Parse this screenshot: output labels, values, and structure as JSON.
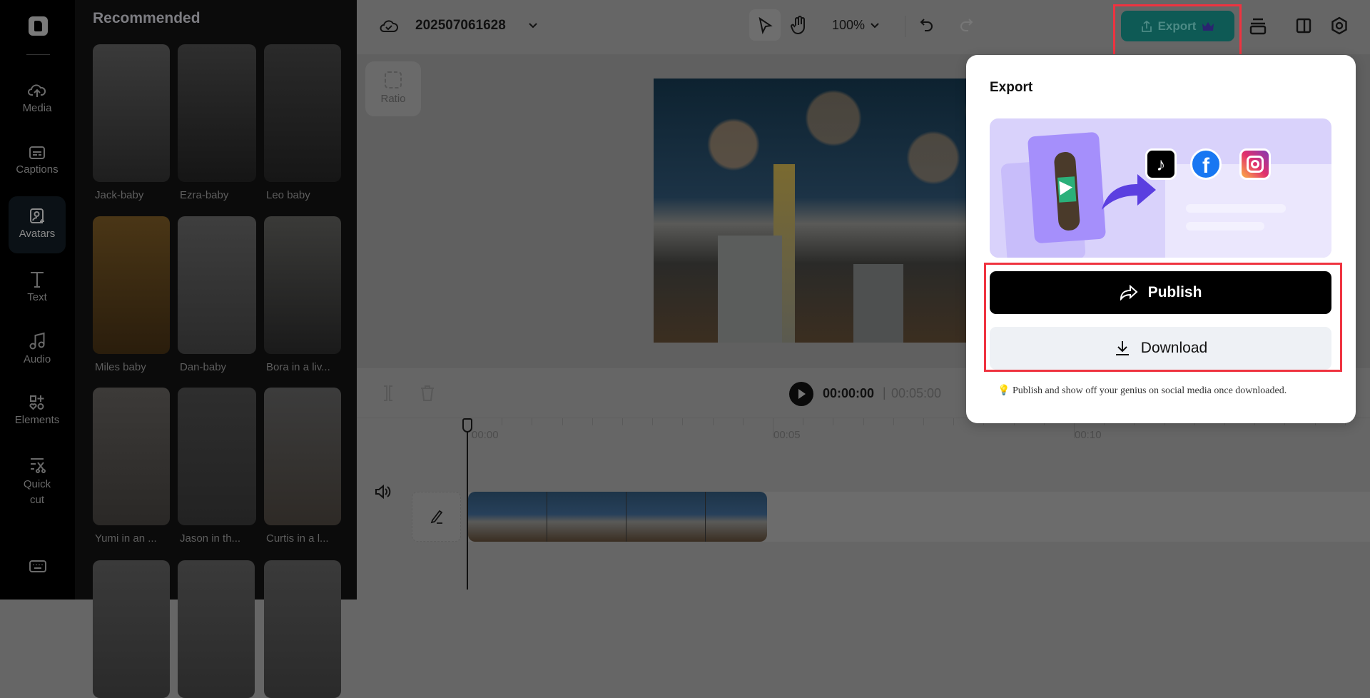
{
  "sidebar": {
    "items": [
      {
        "label": "Media",
        "icon": "cloud-upload-icon"
      },
      {
        "label": "Captions",
        "icon": "captions-icon"
      },
      {
        "label": "Avatars",
        "icon": "avatar-icon",
        "selected": true
      },
      {
        "label": "Text",
        "icon": "text-icon"
      },
      {
        "label": "Audio",
        "icon": "music-icon"
      },
      {
        "label": "Elements",
        "icon": "elements-icon"
      },
      {
        "label": "Quick cut",
        "icon": "quick-cut-icon"
      }
    ]
  },
  "panel": {
    "title": "Recommended",
    "avatars": [
      {
        "name": "Jack-baby"
      },
      {
        "name": "Ezra-baby"
      },
      {
        "name": "Leo baby"
      },
      {
        "name": "Miles baby"
      },
      {
        "name": "Dan-baby"
      },
      {
        "name": "Bora in a liv..."
      },
      {
        "name": "Yumi in an ..."
      },
      {
        "name": "Jason in th..."
      },
      {
        "name": "Curtis in a l..."
      }
    ]
  },
  "header": {
    "project_name": "202507061628",
    "zoom": "100%",
    "export_label": "Export"
  },
  "canvas": {
    "ratio_label": "Ratio"
  },
  "player": {
    "current_time": "00:00:00",
    "separator": "|",
    "duration": "00:05:00"
  },
  "ruler": {
    "labels": [
      "00:00",
      "00:05",
      "00:10"
    ]
  },
  "export_popup": {
    "title": "Export",
    "publish_label": "Publish",
    "download_label": "Download",
    "tip": "Publish and show off your genius on social media once downloaded."
  },
  "colors": {
    "accent": "#0e5a55",
    "highlight": "#ef3340",
    "banner": "#d9d2fb"
  }
}
